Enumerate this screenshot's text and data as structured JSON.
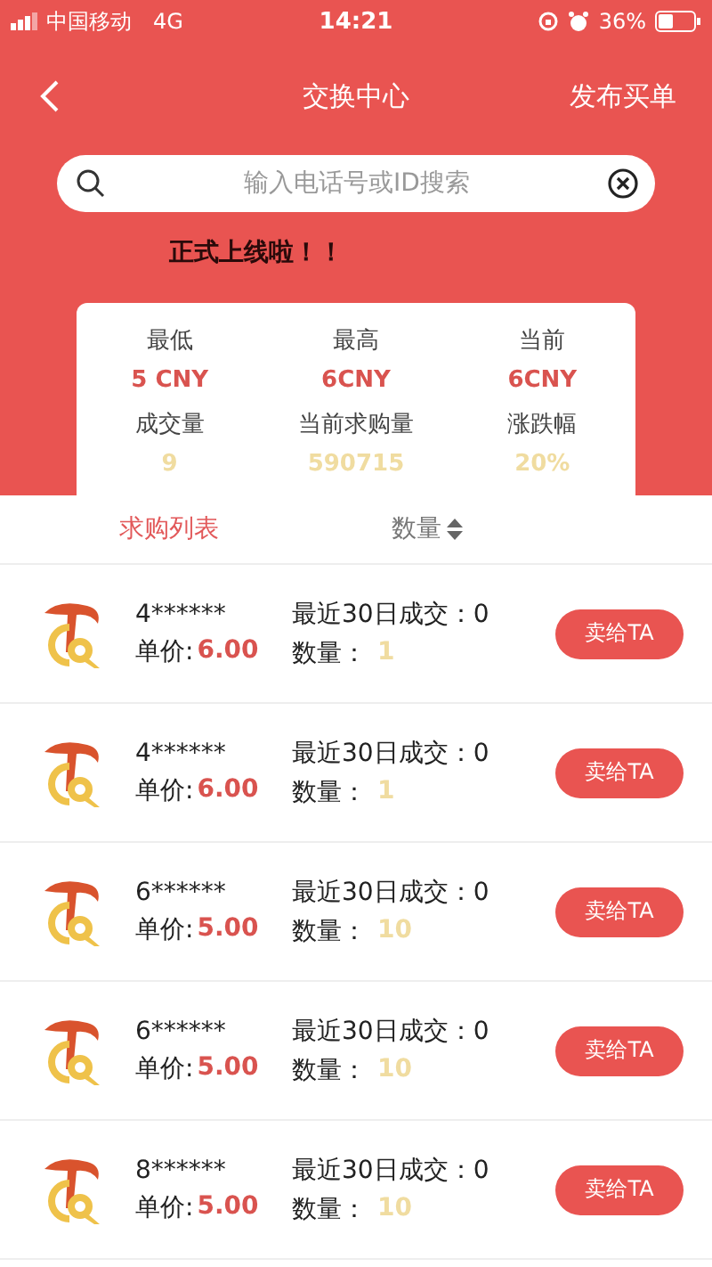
{
  "status_bar": {
    "carrier": "中国移动",
    "network": "4G",
    "time": "14:21",
    "battery": "36%"
  },
  "nav": {
    "title": "交换中心",
    "action": "发布买单"
  },
  "search": {
    "placeholder": "输入电话号或ID搜索"
  },
  "notice": "正式上线啦！！",
  "stats": [
    {
      "label": "最低",
      "value": "5 CNY",
      "kind": "price"
    },
    {
      "label": "最高",
      "value": "6CNY",
      "kind": "price"
    },
    {
      "label": "当前",
      "value": "6CNY",
      "kind": "price"
    },
    {
      "label": "成交量",
      "value": "9",
      "kind": "volume"
    },
    {
      "label": "当前求购量",
      "value": "590715",
      "kind": "volume"
    },
    {
      "label": "涨跌幅",
      "value": "20%",
      "kind": "volume"
    }
  ],
  "tabs": [
    {
      "label": "求购列表",
      "selected": true,
      "sortable": false
    },
    {
      "label": "数量",
      "selected": false,
      "sortable": true
    }
  ],
  "orders": [
    {
      "user": "4******",
      "price_label": "单价:",
      "price": "6.00",
      "recent": "最近30日成交：0",
      "qty_label": "数量：",
      "qty": "1",
      "button": "卖给TA"
    },
    {
      "user": "4******",
      "price_label": "单价:",
      "price": "6.00",
      "recent": "最近30日成交：0",
      "qty_label": "数量：",
      "qty": "1",
      "button": "卖给TA"
    },
    {
      "user": "6******",
      "price_label": "单价:",
      "price": "5.00",
      "recent": "最近30日成交：0",
      "qty_label": "数量：",
      "qty": "10",
      "button": "卖给TA"
    },
    {
      "user": "6******",
      "price_label": "单价:",
      "price": "5.00",
      "recent": "最近30日成交：0",
      "qty_label": "数量：",
      "qty": "10",
      "button": "卖给TA"
    },
    {
      "user": "8******",
      "price_label": "单价:",
      "price": "5.00",
      "recent": "最近30日成交：0",
      "qty_label": "数量：",
      "qty": "10",
      "button": "卖给TA"
    }
  ]
}
